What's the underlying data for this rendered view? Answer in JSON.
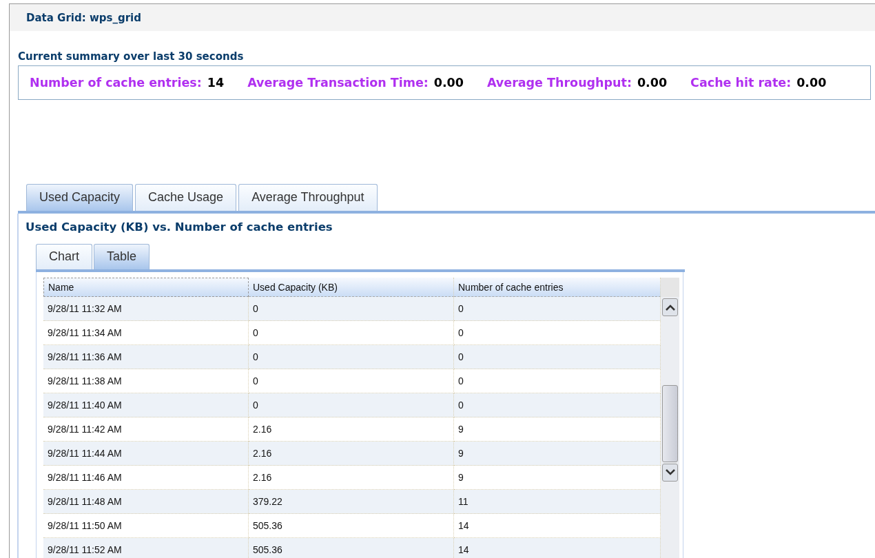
{
  "header": {
    "title": "Data Grid: wps_grid"
  },
  "summary": {
    "title": "Current summary over last 30 seconds",
    "metrics": [
      {
        "label": "Number of cache entries:",
        "value": "14"
      },
      {
        "label": "Average Transaction Time:",
        "value": "0.00"
      },
      {
        "label": "Average Throughput:",
        "value": "0.00"
      },
      {
        "label": "Cache hit rate:",
        "value": "0.00"
      }
    ]
  },
  "tabs": [
    {
      "label": "Used Capacity",
      "selected": true
    },
    {
      "label": "Cache Usage",
      "selected": false
    },
    {
      "label": "Average Throughput",
      "selected": false
    }
  ],
  "panel_title": "Used Capacity (KB) vs. Number of cache entries",
  "view_tabs": [
    {
      "label": "Chart",
      "selected": false
    },
    {
      "label": "Table",
      "selected": true
    }
  ],
  "table": {
    "columns": [
      "Name",
      "Used Capacity (KB)",
      "Number of cache entries"
    ],
    "rows": [
      [
        "9/28/11 11:32 AM",
        "0",
        "0"
      ],
      [
        "9/28/11 11:34 AM",
        "0",
        "0"
      ],
      [
        "9/28/11 11:36 AM",
        "0",
        "0"
      ],
      [
        "9/28/11 11:38 AM",
        "0",
        "0"
      ],
      [
        "9/28/11 11:40 AM",
        "0",
        "0"
      ],
      [
        "9/28/11 11:42 AM",
        "2.16",
        "9"
      ],
      [
        "9/28/11 11:44 AM",
        "2.16",
        "9"
      ],
      [
        "9/28/11 11:46 AM",
        "2.16",
        "9"
      ],
      [
        "9/28/11 11:48 AM",
        "379.22",
        "11"
      ],
      [
        "9/28/11 11:50 AM",
        "505.36",
        "14"
      ],
      [
        "9/28/11 11:52 AM",
        "505.36",
        "14"
      ]
    ]
  }
}
